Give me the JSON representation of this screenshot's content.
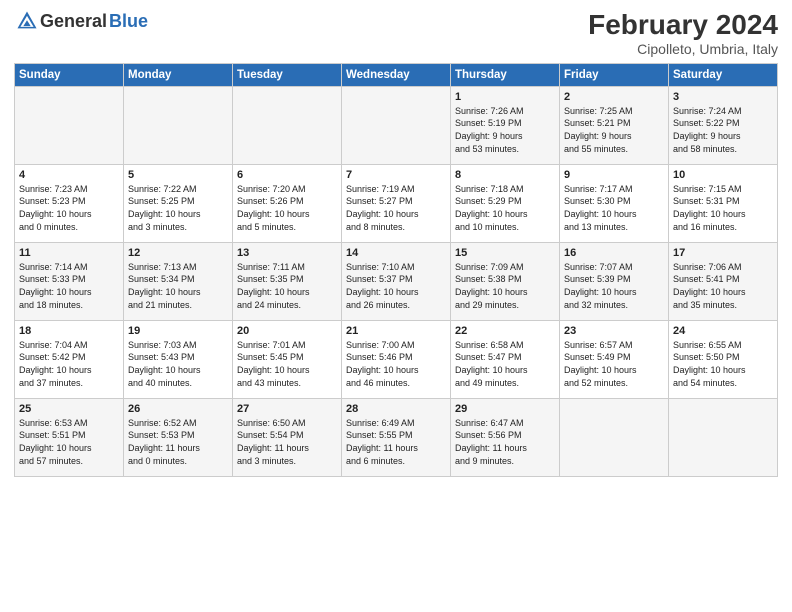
{
  "header": {
    "logo_general": "General",
    "logo_blue": "Blue",
    "title": "February 2024",
    "subtitle": "Cipolleto, Umbria, Italy"
  },
  "weekdays": [
    "Sunday",
    "Monday",
    "Tuesday",
    "Wednesday",
    "Thursday",
    "Friday",
    "Saturday"
  ],
  "weeks": [
    [
      {
        "day": "",
        "info": ""
      },
      {
        "day": "",
        "info": ""
      },
      {
        "day": "",
        "info": ""
      },
      {
        "day": "",
        "info": ""
      },
      {
        "day": "1",
        "info": "Sunrise: 7:26 AM\nSunset: 5:19 PM\nDaylight: 9 hours\nand 53 minutes."
      },
      {
        "day": "2",
        "info": "Sunrise: 7:25 AM\nSunset: 5:21 PM\nDaylight: 9 hours\nand 55 minutes."
      },
      {
        "day": "3",
        "info": "Sunrise: 7:24 AM\nSunset: 5:22 PM\nDaylight: 9 hours\nand 58 minutes."
      }
    ],
    [
      {
        "day": "4",
        "info": "Sunrise: 7:23 AM\nSunset: 5:23 PM\nDaylight: 10 hours\nand 0 minutes."
      },
      {
        "day": "5",
        "info": "Sunrise: 7:22 AM\nSunset: 5:25 PM\nDaylight: 10 hours\nand 3 minutes."
      },
      {
        "day": "6",
        "info": "Sunrise: 7:20 AM\nSunset: 5:26 PM\nDaylight: 10 hours\nand 5 minutes."
      },
      {
        "day": "7",
        "info": "Sunrise: 7:19 AM\nSunset: 5:27 PM\nDaylight: 10 hours\nand 8 minutes."
      },
      {
        "day": "8",
        "info": "Sunrise: 7:18 AM\nSunset: 5:29 PM\nDaylight: 10 hours\nand 10 minutes."
      },
      {
        "day": "9",
        "info": "Sunrise: 7:17 AM\nSunset: 5:30 PM\nDaylight: 10 hours\nand 13 minutes."
      },
      {
        "day": "10",
        "info": "Sunrise: 7:15 AM\nSunset: 5:31 PM\nDaylight: 10 hours\nand 16 minutes."
      }
    ],
    [
      {
        "day": "11",
        "info": "Sunrise: 7:14 AM\nSunset: 5:33 PM\nDaylight: 10 hours\nand 18 minutes."
      },
      {
        "day": "12",
        "info": "Sunrise: 7:13 AM\nSunset: 5:34 PM\nDaylight: 10 hours\nand 21 minutes."
      },
      {
        "day": "13",
        "info": "Sunrise: 7:11 AM\nSunset: 5:35 PM\nDaylight: 10 hours\nand 24 minutes."
      },
      {
        "day": "14",
        "info": "Sunrise: 7:10 AM\nSunset: 5:37 PM\nDaylight: 10 hours\nand 26 minutes."
      },
      {
        "day": "15",
        "info": "Sunrise: 7:09 AM\nSunset: 5:38 PM\nDaylight: 10 hours\nand 29 minutes."
      },
      {
        "day": "16",
        "info": "Sunrise: 7:07 AM\nSunset: 5:39 PM\nDaylight: 10 hours\nand 32 minutes."
      },
      {
        "day": "17",
        "info": "Sunrise: 7:06 AM\nSunset: 5:41 PM\nDaylight: 10 hours\nand 35 minutes."
      }
    ],
    [
      {
        "day": "18",
        "info": "Sunrise: 7:04 AM\nSunset: 5:42 PM\nDaylight: 10 hours\nand 37 minutes."
      },
      {
        "day": "19",
        "info": "Sunrise: 7:03 AM\nSunset: 5:43 PM\nDaylight: 10 hours\nand 40 minutes."
      },
      {
        "day": "20",
        "info": "Sunrise: 7:01 AM\nSunset: 5:45 PM\nDaylight: 10 hours\nand 43 minutes."
      },
      {
        "day": "21",
        "info": "Sunrise: 7:00 AM\nSunset: 5:46 PM\nDaylight: 10 hours\nand 46 minutes."
      },
      {
        "day": "22",
        "info": "Sunrise: 6:58 AM\nSunset: 5:47 PM\nDaylight: 10 hours\nand 49 minutes."
      },
      {
        "day": "23",
        "info": "Sunrise: 6:57 AM\nSunset: 5:49 PM\nDaylight: 10 hours\nand 52 minutes."
      },
      {
        "day": "24",
        "info": "Sunrise: 6:55 AM\nSunset: 5:50 PM\nDaylight: 10 hours\nand 54 minutes."
      }
    ],
    [
      {
        "day": "25",
        "info": "Sunrise: 6:53 AM\nSunset: 5:51 PM\nDaylight: 10 hours\nand 57 minutes."
      },
      {
        "day": "26",
        "info": "Sunrise: 6:52 AM\nSunset: 5:53 PM\nDaylight: 11 hours\nand 0 minutes."
      },
      {
        "day": "27",
        "info": "Sunrise: 6:50 AM\nSunset: 5:54 PM\nDaylight: 11 hours\nand 3 minutes."
      },
      {
        "day": "28",
        "info": "Sunrise: 6:49 AM\nSunset: 5:55 PM\nDaylight: 11 hours\nand 6 minutes."
      },
      {
        "day": "29",
        "info": "Sunrise: 6:47 AM\nSunset: 5:56 PM\nDaylight: 11 hours\nand 9 minutes."
      },
      {
        "day": "",
        "info": ""
      },
      {
        "day": "",
        "info": ""
      }
    ]
  ]
}
